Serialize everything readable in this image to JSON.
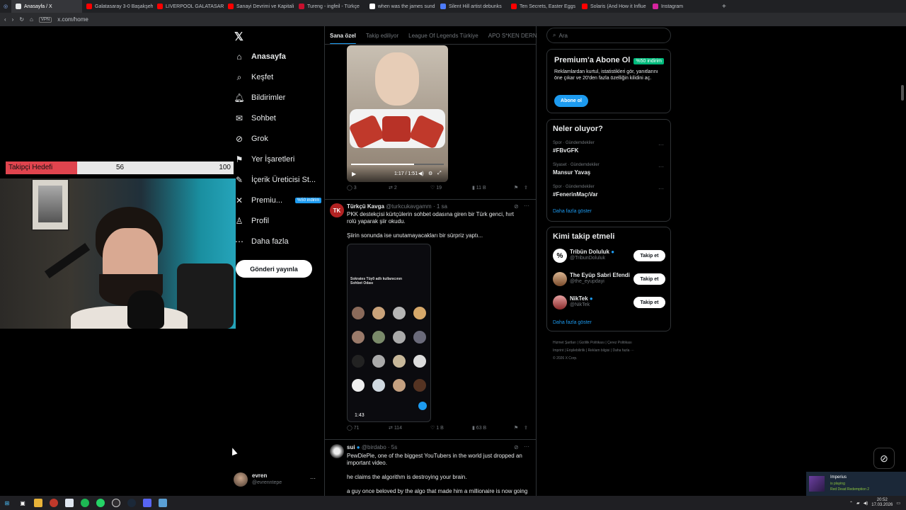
{
  "browser": {
    "tabs": [
      {
        "label": "Anasayfa / X",
        "color": "#e7e9ea",
        "active": true
      },
      {
        "label": "Galatasaray 3-0 Başakşeh",
        "color": "#ff0000"
      },
      {
        "label": "LIVERPOOL GALATASARA",
        "color": "#ff0000"
      },
      {
        "label": "Sanayi Devrimi ve Kapitali",
        "color": "#ff0000"
      },
      {
        "label": "Tureng - ingfeil - Türkçe",
        "color": "#c8102e"
      },
      {
        "label": "when was the james sund",
        "color": "#ffffff"
      },
      {
        "label": "Silent Hill artist debunks",
        "color": "#4d7cfe"
      },
      {
        "label": "Ten Secrets, Easter Eggs",
        "color": "#ff0000"
      },
      {
        "label": "Solaris (And How it Influe",
        "color": "#ff0000"
      },
      {
        "label": "Instagram",
        "color": "#d6249f"
      }
    ],
    "vpn_label": "VPN",
    "url": "x.com/home"
  },
  "nav": {
    "items": [
      {
        "label": "Anasayfa",
        "icon": "home-icon",
        "glyph": "⌂"
      },
      {
        "label": "Keşfet",
        "icon": "search-icon",
        "glyph": "⌕"
      },
      {
        "label": "Bildirimler",
        "icon": "bell-icon",
        "glyph": "🔔︎"
      },
      {
        "label": "Sohbet",
        "icon": "chat-icon",
        "glyph": "✉"
      },
      {
        "label": "Grok",
        "icon": "grok-icon",
        "glyph": "⊘"
      },
      {
        "label": "Yer İşaretleri",
        "icon": "bookmark-icon",
        "glyph": "⚑"
      },
      {
        "label": "İçerik Üreticisi St...",
        "icon": "creator-studio-icon",
        "glyph": "✎"
      },
      {
        "label": "Premiu...",
        "icon": "premium-icon",
        "glyph": "✕"
      },
      {
        "label": "Profil",
        "icon": "profile-icon",
        "glyph": "♙"
      },
      {
        "label": "Daha fazla",
        "icon": "more-icon",
        "glyph": "⋯"
      }
    ],
    "premium_badge": "%50 indirim",
    "post_button": "Gönderi yayınla",
    "account": {
      "name": "evren",
      "handle": "@evrenntepe",
      "more": "···"
    }
  },
  "overlay": {
    "goal_label": "Takipçi Hedefi",
    "goal_current": "56",
    "goal_target": "100",
    "goal_fraction": 0.56
  },
  "feed": {
    "tabs": [
      "Sana özel",
      "Takip ediliyor",
      "League Of Legends Türkiye",
      "APO S*KEN DERNEĞİ"
    ],
    "video_time": "1:17 / 1:51",
    "post1_stats": {
      "replies": "3",
      "reposts": "2",
      "likes": "19",
      "views": "11 B"
    },
    "post2": {
      "name": "Türkçü Kavga",
      "handle": "@turkcukavgamm · 1 sa",
      "avatar": "TK",
      "text1": "PKK destekçisi kürtçülerin sohbet odasına giren bir Türk genci, hırt rolü yaparak şiir okudu.",
      "text2": "Şiirin sonunda ise unutamayacakları bir sürpriz yaptı...",
      "media_title": "Sokrates Tüy0 adlı kullanıcının Sohbet Odası",
      "media_time": "1:43",
      "stats": {
        "replies": "71",
        "reposts": "114",
        "likes": "1 B",
        "views": "63 B"
      }
    },
    "post3": {
      "name": "sui",
      "handle": "@birdabo · 5s",
      "text1": "PewDiePie, one of the biggest YouTubers in the world just dropped an important video.",
      "text2": "he claims the algorithm is destroying your brain.",
      "text3": "a guy once beloved by the algo that made him a millionaire is now going"
    }
  },
  "right": {
    "search_placeholder": "Ara",
    "premium": {
      "title": "Premium'a Abone Ol",
      "badge": "%50 indirim",
      "body": "Reklamlardan kurtul, istatistikleri gör, yanıtlarını öne çıkar ve 20'den fazla özelliğin kilidini aç.",
      "button": "Abone ol"
    },
    "trends": {
      "title": "Neler oluyor?",
      "items": [
        {
          "category": "Spor · Gündemdekiler",
          "name": "#FBvGFK"
        },
        {
          "category": "Siyaset · Gündemdekiler",
          "name": "Mansur Yavaş"
        },
        {
          "category": "Spor · Gündemdekiler",
          "name": "#FenerinMaçıVar"
        }
      ],
      "show_more": "Daha fazla göster"
    },
    "who_to_follow": {
      "title": "Kimi takip etmeli",
      "items": [
        {
          "name": "Tribün Doluluk",
          "handle": "@TribunDoluluk",
          "verified": true
        },
        {
          "name": "The Eyüp Sabri Efendi",
          "handle": "@the_eyupdayi",
          "verified": false
        },
        {
          "name": "NikTek",
          "handle": "@NikTek",
          "verified": true
        }
      ],
      "follow_label": "Takip et",
      "show_more": "Daha fazla göster"
    },
    "footer": {
      "line1": [
        "Hizmet Şartları",
        "Gizlilik Politikası",
        "Çerez Politikası"
      ],
      "line2": [
        "Imprint",
        "Erişilebilirlik",
        "Reklam bilgisi",
        "Daha fazla ···"
      ],
      "copyright": "© 2026 X Corp."
    }
  },
  "notification": {
    "game_user": "Imperius",
    "status": "is playing",
    "game": "Red Dead Redemption 2"
  },
  "taskbar": {
    "time": "20:52",
    "date": "17.03.2026"
  }
}
